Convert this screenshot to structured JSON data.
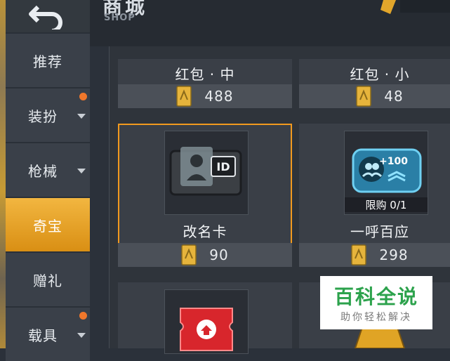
{
  "header": {
    "title": "商城",
    "subtitle": "SHOP"
  },
  "sidebar": {
    "items": [
      {
        "label": "推荐"
      },
      {
        "label": "装扮"
      },
      {
        "label": "枪械"
      },
      {
        "label": "奇宝"
      },
      {
        "label": "赠礼"
      },
      {
        "label": "载具"
      }
    ]
  },
  "products": [
    {
      "name": "红包 · 中",
      "price": "488"
    },
    {
      "name": "红包 · 小",
      "price": "48"
    },
    {
      "name": "改名卡",
      "price": "90"
    },
    {
      "name": "一呼百应",
      "price": "298",
      "limit": "限购 0/1",
      "tag": "+100"
    }
  ],
  "watermark": {
    "main": "百科全说",
    "sub": "助你轻松解决"
  },
  "colors": {
    "accent": "#f29a1e",
    "active_tab": "#e9a32a",
    "badge": "#f0772b"
  }
}
